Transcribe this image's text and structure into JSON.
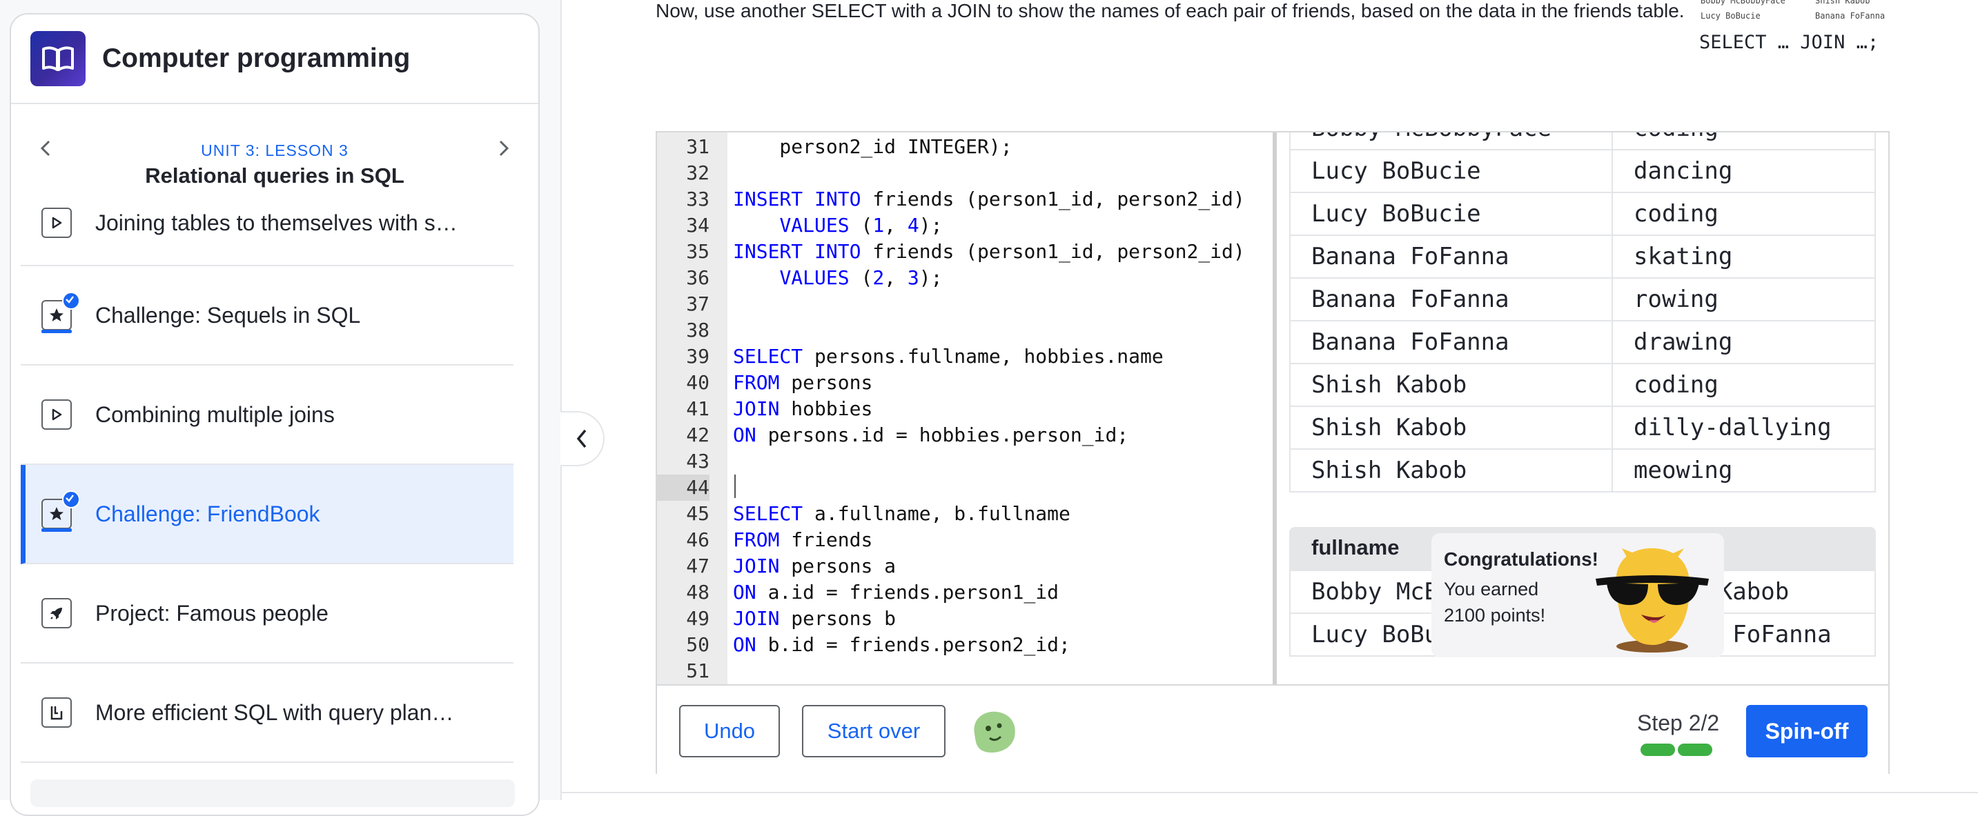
{
  "sidebar": {
    "course_title": "Computer programming",
    "unit_label": "UNIT 3: LESSON 3",
    "lesson_title": "Relational queries in SQL",
    "prev_icon": "chevron-left-icon",
    "next_icon": "chevron-right-icon",
    "items": [
      {
        "label": "Joining tables to themselves with s…",
        "icon": "play-icon",
        "completed": false,
        "active": false
      },
      {
        "label": "Challenge: Sequels in SQL",
        "icon": "star-icon",
        "completed": true,
        "active": false
      },
      {
        "label": "Combining multiple joins",
        "icon": "play-icon",
        "completed": false,
        "active": false
      },
      {
        "label": "Challenge: FriendBook",
        "icon": "star-icon",
        "completed": true,
        "active": true
      },
      {
        "label": "Project: Famous people",
        "icon": "rocket-icon",
        "completed": false,
        "active": false
      },
      {
        "label": "More efficient SQL with query plan…",
        "icon": "article-icon",
        "completed": false,
        "active": false
      }
    ]
  },
  "instruction": "Now, use another SELECT with a JOIN to show the names of each pair of friends, based on the data in the friends table.",
  "hint": {
    "mini_rows": [
      [
        "Bobby McBobbyFace",
        "Shish Kabob"
      ],
      [
        "Lucy BoBucie",
        "Banana FoFanna"
      ]
    ],
    "code": "SELECT … JOIN …;"
  },
  "editor": {
    "current_line": 44,
    "lines": [
      {
        "n": 31,
        "t": "    person2_id INTEGER);"
      },
      {
        "n": 32,
        "t": ""
      },
      {
        "n": 33,
        "t": "INSERT INTO friends (person1_id, person2_id)"
      },
      {
        "n": 34,
        "t": "    VALUES (1, 4);"
      },
      {
        "n": 35,
        "t": "INSERT INTO friends (person1_id, person2_id)"
      },
      {
        "n": 36,
        "t": "    VALUES (2, 3);"
      },
      {
        "n": 37,
        "t": ""
      },
      {
        "n": 38,
        "t": ""
      },
      {
        "n": 39,
        "t": "SELECT persons.fullname, hobbies.name"
      },
      {
        "n": 40,
        "t": "FROM persons"
      },
      {
        "n": 41,
        "t": "JOIN hobbies"
      },
      {
        "n": 42,
        "t": "ON persons.id = hobbies.person_id;"
      },
      {
        "n": 43,
        "t": ""
      },
      {
        "n": 44,
        "t": ""
      },
      {
        "n": 45,
        "t": "SELECT a.fullname, b.fullname"
      },
      {
        "n": 46,
        "t": "FROM friends"
      },
      {
        "n": 47,
        "t": "JOIN persons a"
      },
      {
        "n": 48,
        "t": "ON a.id = friends.person1_id"
      },
      {
        "n": 49,
        "t": "JOIN persons b"
      },
      {
        "n": 50,
        "t": "ON b.id = friends.person2_id;"
      },
      {
        "n": 51,
        "t": ""
      }
    ]
  },
  "output": {
    "hobbies_rows": [
      [
        "Bobby McBobbyFace",
        "coding"
      ],
      [
        "Lucy BoBucie",
        "dancing"
      ],
      [
        "Lucy BoBucie",
        "coding"
      ],
      [
        "Banana FoFanna",
        "skating"
      ],
      [
        "Banana FoFanna",
        "rowing"
      ],
      [
        "Banana FoFanna",
        "drawing"
      ],
      [
        "Shish Kabob",
        "coding"
      ],
      [
        "Shish Kabob",
        "dilly-dallying"
      ],
      [
        "Shish Kabob",
        "meowing"
      ]
    ],
    "friends_header": "fullname",
    "friends_rows": [
      [
        "Bobby McBobbyFace",
        "Shish Kabob"
      ],
      [
        "Lucy BoBucie",
        "Banana FoFanna"
      ]
    ]
  },
  "congrats": {
    "title": "Congratulations!",
    "line1": "You earned",
    "line2": "2100 points!"
  },
  "toolbar": {
    "undo_label": "Undo",
    "start_over_label": "Start over",
    "step_label": "Step 2/2",
    "spinoff_label": "Spin-off",
    "steps_completed": 2,
    "steps_total": 2
  },
  "colors": {
    "accent": "#1865f2",
    "progress": "#3cb043",
    "keyword": "#0000ff"
  }
}
